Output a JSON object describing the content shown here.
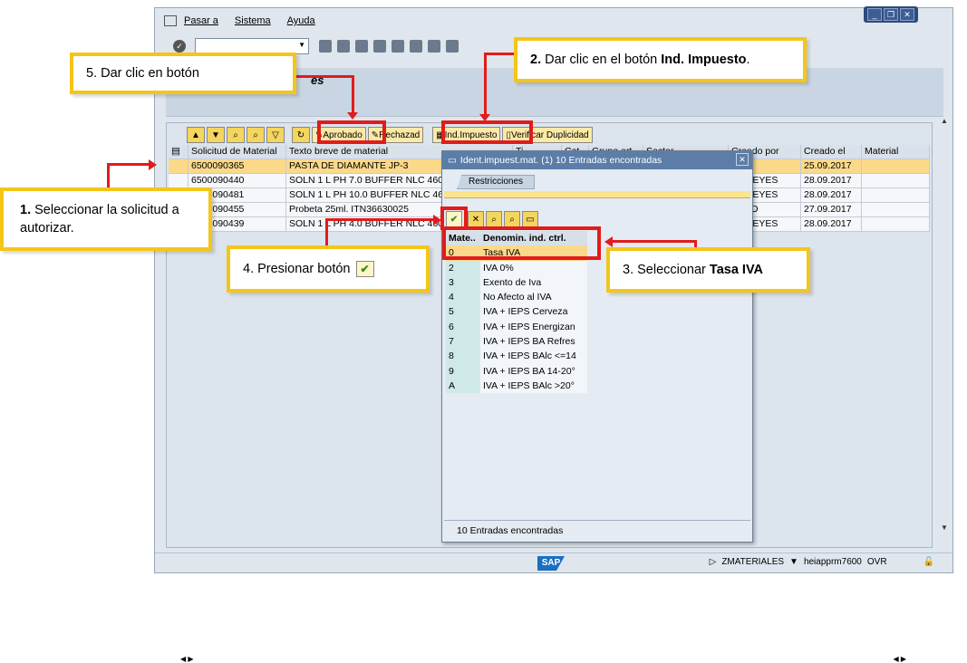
{
  "menu": {
    "items": [
      "Pasar a",
      "Sistema",
      "Ayuda"
    ]
  },
  "window_buttons": {
    "minimize": "_",
    "restore": "❐",
    "close": "✕"
  },
  "title_fragment": "es",
  "alv_toolbar": {
    "approve_label": "Aprobado",
    "reject_label": "Rechazad",
    "tax_label": "Ind.Impuesto",
    "verify_label": "Verificar Duplicidad"
  },
  "table": {
    "columns": [
      "Solicitud de Material",
      "Texto breve de material",
      "Ti...",
      "Cat",
      "Grupo art.",
      "Sector",
      "Creado por",
      "Creado el",
      "Material"
    ],
    "rows": [
      {
        "id": "6500090365",
        "text": "PASTA DE DIAMANTE JP-3",
        "by": "...86",
        "date": "25.09.2017",
        "selected": true
      },
      {
        "id": "6500090440",
        "text": "SOLN 1 L PH 7.0 BUFFER NLC 460-S",
        "by": "MAREYES",
        "date": "28.09.2017",
        "selected": false
      },
      {
        "id": "6500090481",
        "text": "SOLN 1 L PH 10.0 BUFFER NLC 460-",
        "by": "MAREYES",
        "date": "28.09.2017",
        "selected": false
      },
      {
        "id": "6500090455",
        "text": "Probeta 25ml. ITN36630025",
        "by": "MTTO",
        "date": "27.09.2017",
        "selected": false
      },
      {
        "id": "6500090439",
        "text": "SOLN 1 L PH 4.0 BUFFER NLC 460-S",
        "by": "MAREYES",
        "date": "28.09.2017",
        "selected": false
      }
    ]
  },
  "dialog": {
    "title": "Ident.impuest.mat. (1)   10 Entradas encontradas",
    "tab": "Restricciones",
    "col_key": "Mate..",
    "col_desc": "Denomin. ind. ctrl.",
    "items": [
      {
        "k": "0",
        "d": "Tasa IVA",
        "selected": true
      },
      {
        "k": "2",
        "d": "IVA 0%",
        "selected": false
      },
      {
        "k": "3",
        "d": "Exento de Iva",
        "selected": false
      },
      {
        "k": "4",
        "d": "No Afecto al IVA",
        "selected": false
      },
      {
        "k": "5",
        "d": "IVA + IEPS Cerveza",
        "selected": false
      },
      {
        "k": "6",
        "d": "IVA + IEPS Energizan",
        "selected": false
      },
      {
        "k": "7",
        "d": "IVA + IEPS BA Refres",
        "selected": false
      },
      {
        "k": "8",
        "d": "IVA + IEPS BAlc <=14",
        "selected": false
      },
      {
        "k": "9",
        "d": "IVA + IEPS BA 14-20°",
        "selected": false
      },
      {
        "k": "A",
        "d": "IVA + IEPS BAlc >20°",
        "selected": false
      }
    ],
    "footer": "10 Entradas encontradas"
  },
  "status": {
    "sap": "SAP",
    "program": "ZMATERIALES",
    "server": "heiapprm7600",
    "mode": "OVR"
  },
  "notes": {
    "n1_bold": "1.",
    "n1": " Seleccionar la solicitud a autorizar.",
    "n2_pre": "2.",
    "n2": " Dar clic en el botón ",
    "n2_bold": "Ind. Impuesto",
    "n2_end": ".",
    "n3": "3. Seleccionar ",
    "n3_bold": "Tasa IVA",
    "n4": "4. Presionar botón",
    "n5": "5. Dar clic en botón"
  },
  "colors": {
    "highlight": "#e21b1b",
    "note_border": "#f5c518",
    "selection": "#fbd98a"
  }
}
